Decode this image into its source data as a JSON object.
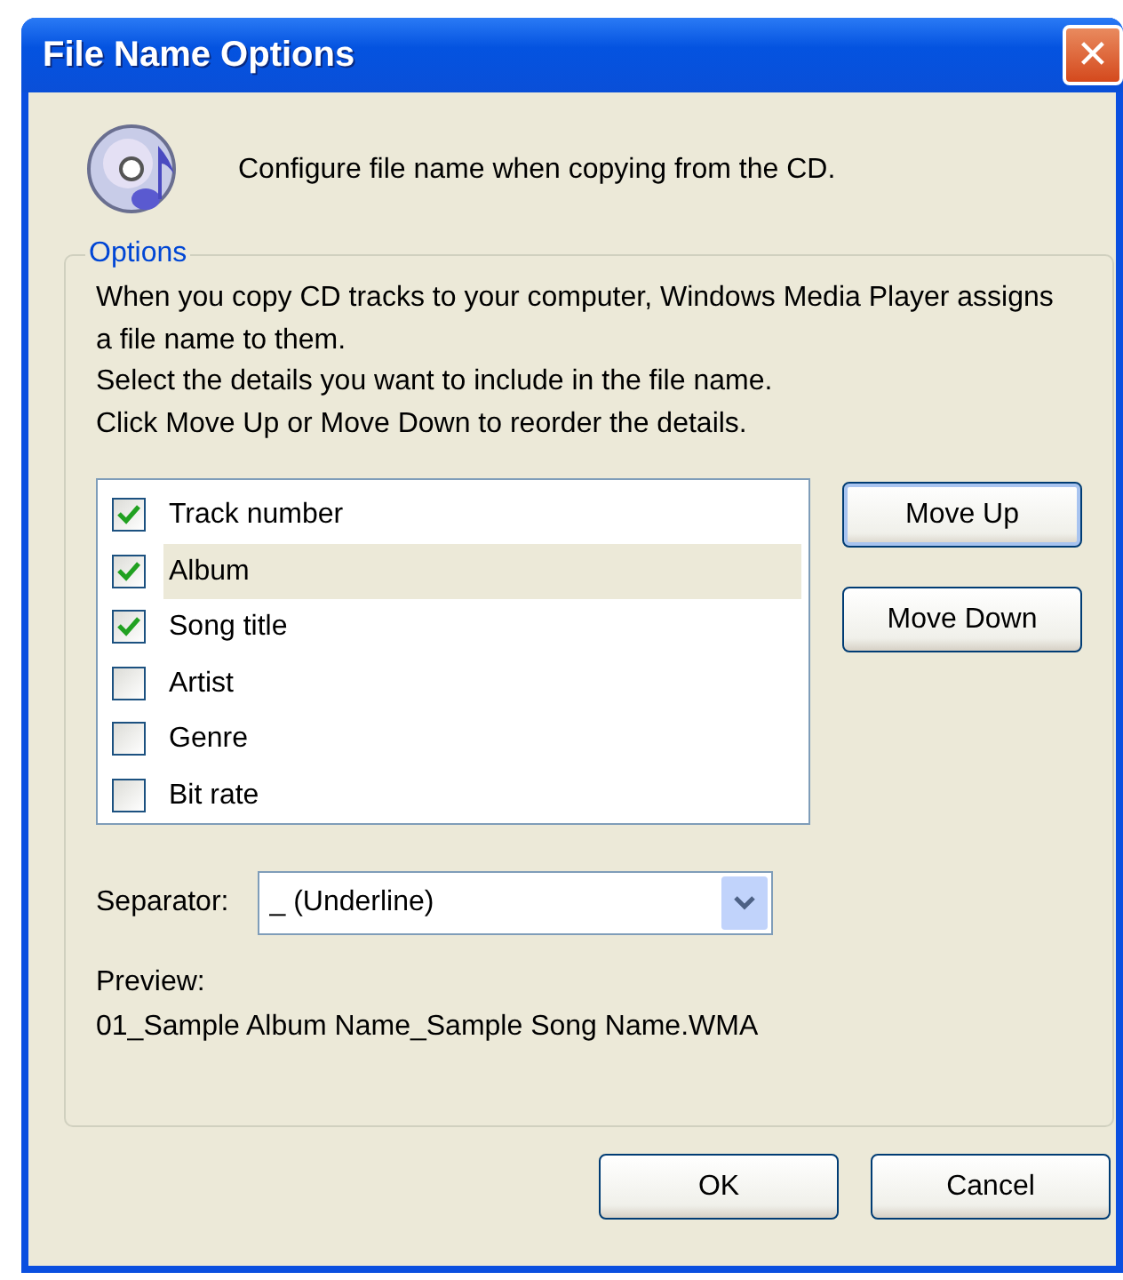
{
  "window": {
    "title": "File Name Options",
    "close": "✕"
  },
  "header": "Configure file name when copying from the CD.",
  "options": {
    "legend": "Options",
    "description": [
      "When you copy CD tracks to your computer, Windows Media Player assigns a file name to them.",
      "Select the details you want to include in the file name.",
      "Click Move Up or Move Down to reorder the details."
    ],
    "details": [
      {
        "label": "Track number",
        "checked": true,
        "selected": false
      },
      {
        "label": "Album",
        "checked": true,
        "selected": true
      },
      {
        "label": "Song title",
        "checked": true,
        "selected": false
      },
      {
        "label": "Artist",
        "checked": false,
        "selected": false
      },
      {
        "label": "Genre",
        "checked": false,
        "selected": false
      },
      {
        "label": "Bit rate",
        "checked": false,
        "selected": false
      }
    ],
    "move_buttons": [
      "Move Up",
      "Move Down"
    ],
    "separator": {
      "label": "Separator:",
      "value": "_ (Underline)"
    },
    "preview": {
      "label": "Preview:",
      "value": "01_Sample Album Name_Sample Song Name.WMA"
    }
  },
  "buttons": [
    "OK",
    "Cancel"
  ]
}
